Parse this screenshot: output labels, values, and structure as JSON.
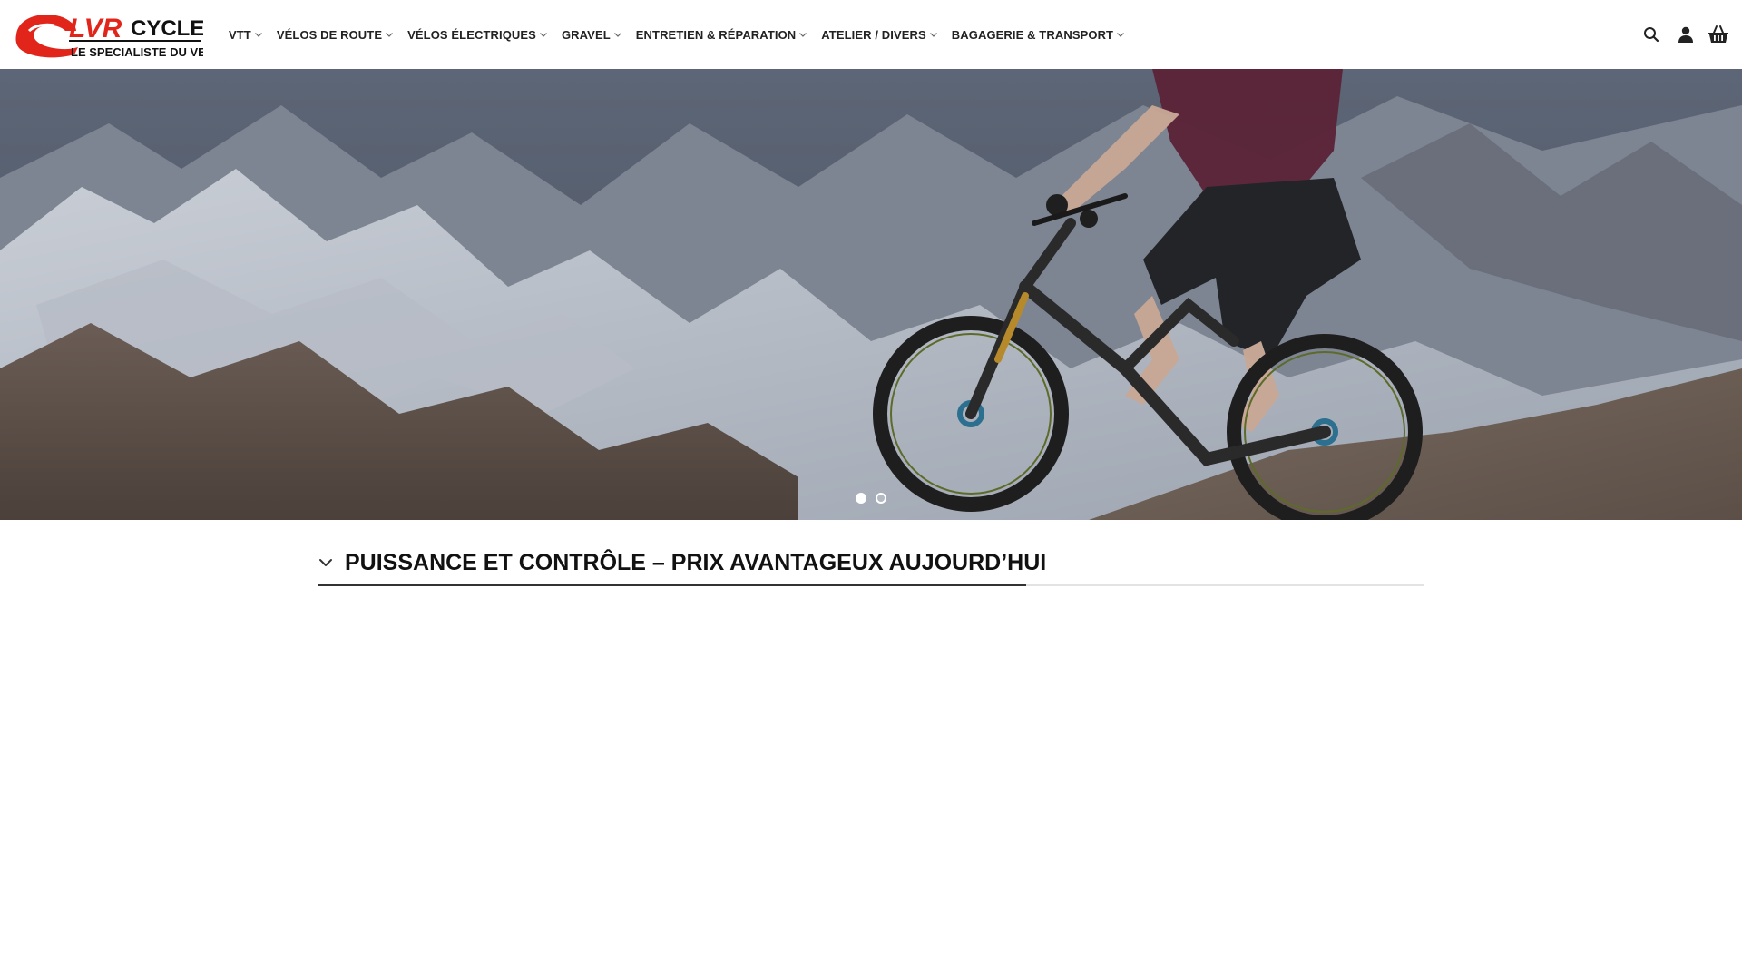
{
  "brand": {
    "logo_main": "LVR",
    "logo_sub": "CYCLES",
    "logo_tagline": "LE SPECIALISTE DU VELO",
    "accent_color": "#e1251b"
  },
  "nav": {
    "items": [
      {
        "label": "VTT",
        "icon": "chevron-down-icon"
      },
      {
        "label": "VÉLOS DE ROUTE",
        "icon": "chevron-down-icon"
      },
      {
        "label": "VÉLOS ÉLECTRIQUES",
        "icon": "chevron-down-icon"
      },
      {
        "label": "GRAVEL",
        "icon": "chevron-down-icon"
      },
      {
        "label": "ENTRETIEN & RÉPARATION",
        "icon": "chevron-down-icon"
      },
      {
        "label": "ATELIER / DIVERS",
        "icon": "chevron-down-icon"
      },
      {
        "label": "BAGAGERIE & TRANSPORT",
        "icon": "chevron-down-icon"
      }
    ]
  },
  "header_icons": [
    "search-icon",
    "user-icon",
    "basket-icon"
  ],
  "slider": {
    "slide_count": 2,
    "active_slide": 1
  },
  "accordion": {
    "title": "PUISSANCE ET CONTRÔLE – PRIX AVANTAGEUX AUJOURD’HUI",
    "icon": "chevron-down-icon",
    "expanded": true
  }
}
